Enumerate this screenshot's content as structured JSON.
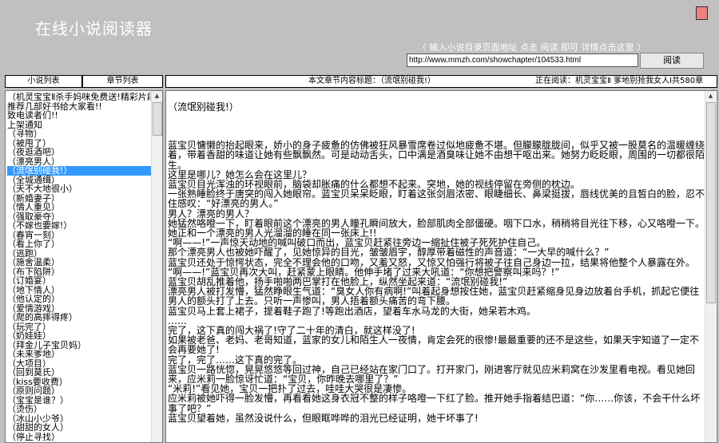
{
  "app": {
    "title": "在线小说阅读器"
  },
  "hint": "〈 输入小说目录页面地址 点击 阅读 即可 详情点击这里 〉",
  "url_input": {
    "value": "http://www.mmzh.com/showchapter/104533.html"
  },
  "read_button": "阅读",
  "tabs": {
    "novel_list": "小说列表",
    "chapter_list": "章节列表"
  },
  "header": {
    "chapter_title": "本文章节内容标题：（流氓别碰我!）",
    "now_reading": "正在阅读：机灵宝宝Ⅱ 爹地别抢我女人Ⅰ共580章"
  },
  "chapters": [
    "（机灵宝宝Ⅱ杀手妈咪免费送!精彩片段",
    "推荐几部好书给大家看!!",
    "致电读者们!!",
    "上架通知",
    "（寻物）",
    "（被甩了）",
    "（夜逛酒吧）",
    "（漂亮男人）",
    "（流氓别碰我!）",
    "（全城通缉）",
    "（天不大地很小）",
    "（新婚妻子）",
    "（情人重见）",
    "（强取豪夺）",
    "（不嫁也要嫁!）",
    "（春宵一刻）",
    "（看上你了）",
    "（逃跑）",
    "（施舍温柔）",
    "（布下陷阱）",
    "（订婚宴）",
    "（地下情人）",
    "（他认定的）",
    "（爱情游戏）",
    "（爬的高摔得疼）",
    "（玩完了）",
    "（奶娃娃）",
    "（拜金儿子宝贝妈）",
    "（未来爹地）",
    "（大项目）",
    "（回到莫氏）",
    "（kiss要收费）",
    "（原则问题）",
    "（宝宝是谁？）",
    "（烫伤）",
    "（冰山小少爷）",
    "（甜甜的女人）",
    "（停止寻找）"
  ],
  "selected_chapter": "（流氓别碰我!）",
  "content": {
    "heading": "（流氓别碰我!）",
    "paragraphs": [
      "蓝宝贝慵懒的抬起眼来，娇小的身子疲惫的仿佛被狂风暴雪席卷过似地疲惫不堪。但朦朦胧胧间，似乎又被一股莫名的温暖缠绕着，带着香甜的味道让她有些飘飘然。可是动动舌头，口中满是酒臭味让她不由想干呕出来。她努力眨眨眼，周围的一切都很陌生。",
      "这里是哪儿？她怎么会在这里儿？",
      "蓝宝贝目光浑浊的环视眼前，脑袋却胀痛的什么都想不起来。突地，她的视线停留在旁侧的枕边。",
      "一张熟睡脸终于唐突的闯入她眼帘。蓝宝贝呆呆眨眼，盯着这张剑眉浓密、眼睫细长、鼻梁挺拔，唇线优美的且皙白的脸，忍不住感叹：“好漂亮的男人。”",
      "男人？漂亮的男人？",
      "她猛然咯噔一下，盯着眼前这个漂亮的男人瞳孔瞬间放大，脸部肌肉全部僵硬。咽下口水，稍稍将目光往下移，心又咯噔一下。",
      "她正和一个漂亮的男人光溜溜的睡在同一张床上!!",
      "“啊——!”一声惊天动地的喊叫破口而出，蓝宝贝赶紧往旁边一缩扯住被子死死护住自己。",
      "那个漂亮男人也被她吓醒了，见她惊异的目光，皱皱眉宇，醇厚带着磁性的声音道：“一大早的喊什么？”",
      "蓝宝贝还处于惊愕状态，完全不理会他的口吻，又羞又怒，又惊又怕强行将被子往自己身边一拉，结果将他整个人暴露在外。",
      "“啊——!”蓝宝贝再次大叫，赶紧蒙上眼睛。他伸手堵了过来大吼道：“你想把警察叫来吗？!”",
      "蓝宝贝胡乱推着他，扬手啪啪两巴掌打在他脸上，纵然坐起来道：“流氓别碰我!”",
      "漂亮男人被打发懵，猛然睁眼生气道：“臭女人你有病啊!”叫着起身想按住她，蓝宝贝赶紧缩身见身边放着台手机，抓起它便往男人的额头打了上去。只听一声惨叫，男人捂着额头痛苦的弯下腰。",
      "蓝宝贝马上套上裙子，提着鞋子跑了!等跑出酒店，望着车水马龙的大街，她呆若木鸡。",
      "……",
      "完了，这下真的闯大祸了!守了二十年的清白，就这样没了!",
      "如果被老爸、老妈、老哥知道，蓝家的女儿和陌生人一夜情，肯定会死的很惨!最最重要的还不是这些，如果天宇知道了一定不会再要她了!",
      "完了，完了……这下真的完了。",
      "蓝宝贝一路恍惚，晃晃悠悠等回过神，自己已经站在家门口了。打开家门，刚进客厅就见应米莉窝在沙发里看电视。看见她回来，应米莉一脸惊讶忙道：“宝贝，你昨晚去哪里了？”",
      "“米莉!”看见她，宝贝一把扑了过去，哇哇大哭很是凄惨。",
      "应米莉被她吓得一脸发懵，再看看她这身衣冠不整的样子咯噔一下红了脸。推开她手指着结巴道：“你……你该，不会干什么坏事了吧？”",
      "蓝宝贝望着她，虽然没说什么，但眼眶哗哗的泪光已经证明，她干坏事了!"
    ]
  }
}
